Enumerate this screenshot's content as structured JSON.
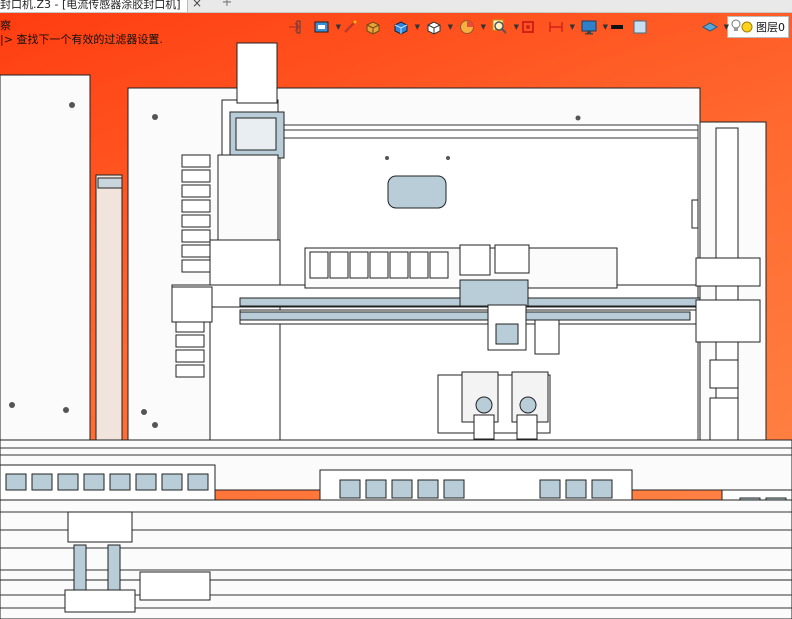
{
  "tab": {
    "title": "封口机.Z3 - [电流传感器涂胶封口机]",
    "close_glyph": "×",
    "new_glyph": "+"
  },
  "console": {
    "line1": "察",
    "line2": "|> 查找下一个有效的过滤器设置."
  },
  "hud": {
    "tools": [
      {
        "icon": "orient-arrow-icon"
      },
      {
        "icon": "view-cube-icon",
        "dropdown": true
      },
      {
        "icon": "pencil-sketch-icon"
      },
      {
        "icon": "shaded-solid-icon"
      },
      {
        "icon": "blue-cube-icon",
        "dropdown": true
      },
      {
        "icon": "white-cube-icon",
        "dropdown": true
      },
      {
        "icon": "section-pie-icon",
        "dropdown": true
      },
      {
        "icon": "zoom-magnifier-icon",
        "dropdown": true
      },
      {
        "icon": "red-frame-icon"
      },
      {
        "icon": "dimension-icon",
        "dropdown": true
      },
      {
        "icon": "monitor-display-icon",
        "dropdown": true
      },
      {
        "icon": "line-color-swatch-icon"
      },
      {
        "icon": "fill-color-swatch-icon"
      }
    ],
    "layer_label": "图层0",
    "colors": {
      "background_red": "#ff3d10",
      "model_blue": "#b8cdd8",
      "line_dark": "#1e1e1e"
    }
  }
}
